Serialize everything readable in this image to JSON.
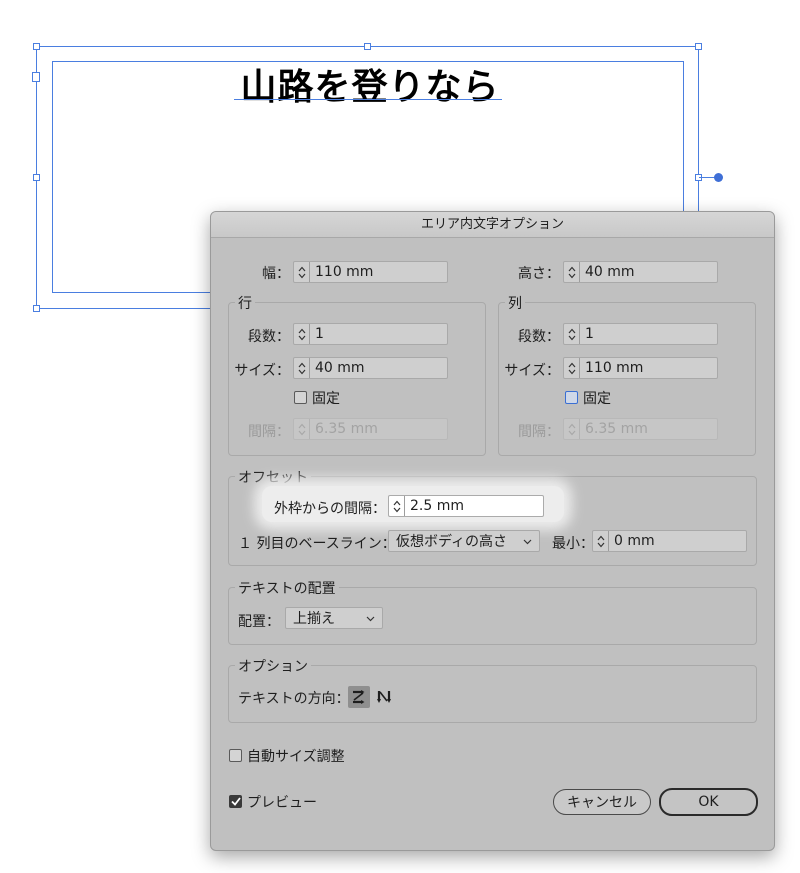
{
  "artboard": {
    "text": "山路を登りなら"
  },
  "dialog": {
    "title": "エリア内文字オプション",
    "width": {
      "label": "幅：",
      "value": "110 mm"
    },
    "height": {
      "label": "高さ：",
      "value": "40 mm"
    },
    "rows": {
      "title": "行",
      "count": {
        "label": "段数：",
        "value": "1"
      },
      "size": {
        "label": "サイズ：",
        "value": "40 mm"
      },
      "fixed": {
        "label": "固定",
        "checked": false
      },
      "gutter": {
        "label": "間隔：",
        "value": "6.35 mm"
      }
    },
    "columns": {
      "title": "列",
      "count": {
        "label": "段数：",
        "value": "1"
      },
      "size": {
        "label": "サイズ：",
        "value": "110 mm"
      },
      "fixed": {
        "label": "固定",
        "checked": false
      },
      "gutter": {
        "label": "間隔：",
        "value": "6.35 mm"
      }
    },
    "offset": {
      "title": "オフセット",
      "inset": {
        "label": "外枠からの間隔：",
        "value": "2.5 mm"
      },
      "baseline": {
        "label": "１ 列目のベースライン：",
        "selected": "仮想ボディの高さ"
      },
      "min": {
        "label": "最小：",
        "value": "0 mm"
      }
    },
    "alignment": {
      "title": "テキストの配置",
      "align": {
        "label": "配置：",
        "selected": "上揃え"
      }
    },
    "options": {
      "title": "オプション",
      "direction": {
        "label": "テキストの方向："
      }
    },
    "auto_size": {
      "label": "自動サイズ調整",
      "checked": false
    },
    "preview": {
      "label": "プレビュー",
      "checked": true
    },
    "cancel_label": "キャンセル",
    "ok_label": "OK"
  },
  "colors": {
    "selection": "#4a7ee0",
    "dialog_bg": "#c0c0c0"
  }
}
